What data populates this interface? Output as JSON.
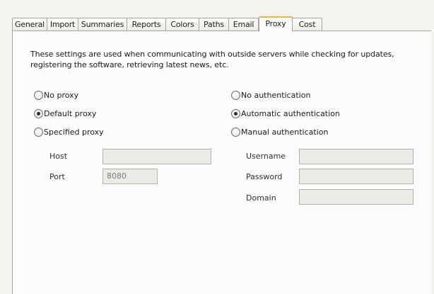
{
  "tabs": [
    {
      "label": "General",
      "active": false
    },
    {
      "label": "Import",
      "active": false
    },
    {
      "label": "Summaries",
      "active": false
    },
    {
      "label": "Reports",
      "active": false
    },
    {
      "label": "Colors",
      "active": false
    },
    {
      "label": "Paths",
      "active": false
    },
    {
      "label": "Email",
      "active": false
    },
    {
      "label": "Proxy",
      "active": true
    },
    {
      "label": "Cost",
      "active": false
    }
  ],
  "description": "These settings are used when communicating with outside servers while checking for updates, registering the software, retrieving latest news, etc.",
  "proxy": {
    "options": [
      {
        "label": "No proxy",
        "checked": false
      },
      {
        "label": "Default proxy",
        "checked": true
      },
      {
        "label": "Specified proxy",
        "checked": false
      }
    ],
    "host_label": "Host",
    "host_value": "",
    "port_label": "Port",
    "port_value": "8080"
  },
  "authentication": {
    "options": [
      {
        "label": "No authentication",
        "checked": false
      },
      {
        "label": "Automatic authentication",
        "checked": true
      },
      {
        "label": "Manual authentication",
        "checked": false
      }
    ],
    "username_label": "Username",
    "username_value": "",
    "password_label": "Password",
    "password_value": "",
    "domain_label": "Domain",
    "domain_value": ""
  }
}
